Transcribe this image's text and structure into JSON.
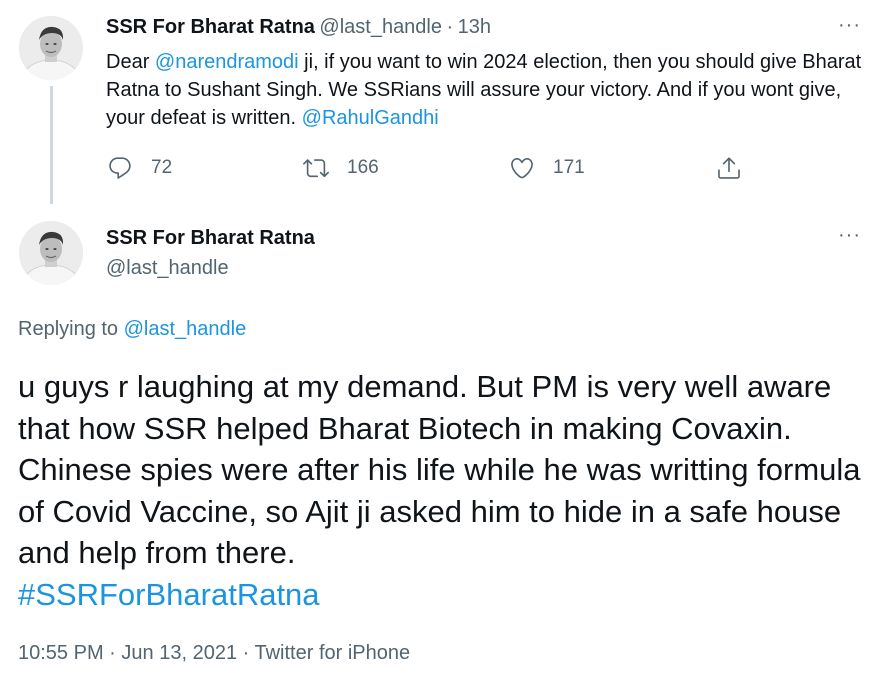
{
  "tweet1": {
    "display_name": "SSR For Bharat Ratna",
    "handle": "@last_handle",
    "separator": "·",
    "time": "13h",
    "text_parts": {
      "t1": "Dear ",
      "mention1": "@narendramodi",
      "t2": " ji, if you want to win 2024 election, then you should give Bharat Ratna to Sushant Singh. We SSRians will assure your victory. And if you wont give, your defeat is written. ",
      "mention2": "@RahulGandhi"
    },
    "actions": {
      "reply": {
        "icon": "reply-icon",
        "count": "72"
      },
      "retweet": {
        "icon": "retweet-icon",
        "count": "166"
      },
      "like": {
        "icon": "heart-icon",
        "count": "171"
      },
      "share": {
        "icon": "share-icon"
      }
    },
    "more": "···"
  },
  "tweet2": {
    "display_name": "SSR For Bharat Ratna",
    "handle": "@last_handle",
    "more": "···",
    "replying_prefix": "Replying to ",
    "replying_handle": "@last_handle",
    "text": "u guys r laughing at my demand. But PM is very well aware that how SSR helped Bharat Biotech in making Covaxin. Chinese spies were after his life while he was writting formula of Covid Vaccine, so Ajit ji asked him to hide in a safe house and help from there.",
    "hashtag": "#SSRForBharatRatna",
    "meta": {
      "time": "10:55 PM",
      "separator": "·",
      "date": "Jun 13, 2021",
      "source": "Twitter for iPhone"
    }
  },
  "colors": {
    "link": "#1b95e0",
    "secondary_text": "#536471",
    "primary_text": "#0f1419",
    "thread_line": "#cfd9de"
  }
}
